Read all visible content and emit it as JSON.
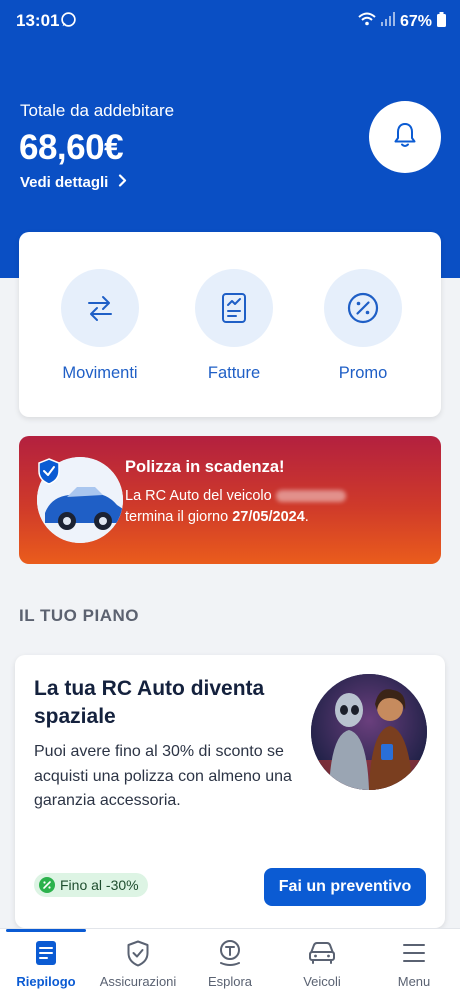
{
  "status_bar": {
    "time": "13:01",
    "battery": "67%"
  },
  "header": {
    "total_label": "Totale da addebitare",
    "total_amount": "68,60€",
    "details_link": "Vedi dettagli"
  },
  "quick_actions": [
    {
      "label": "Movimenti",
      "icon": "transfer-arrows-icon"
    },
    {
      "label": "Fatture",
      "icon": "invoice-icon"
    },
    {
      "label": "Promo",
      "icon": "percent-icon"
    }
  ],
  "alert": {
    "title": "Polizza in scadenza!",
    "text_prefix": "La RC Auto del veicolo",
    "text_middle": "termina il giorno",
    "date": "27/05/2024",
    "suffix": "."
  },
  "plan_section": {
    "title": "IL TUO PIANO",
    "card_title": "La tua RC Auto diventa spaziale",
    "card_body": "Puoi avere fino al 30% di sconto se acquisti una polizza con almeno una garanzia accessoria.",
    "badge": "Fino al -30%",
    "cta": "Fai un preventivo"
  },
  "bottom_nav": [
    {
      "label": "Riepilogo",
      "icon": "document-list-icon",
      "active": true
    },
    {
      "label": "Assicurazioni",
      "icon": "shield-check-icon",
      "active": false
    },
    {
      "label": "Esplora",
      "icon": "compass-pin-icon",
      "active": false
    },
    {
      "label": "Veicoli",
      "icon": "car-icon",
      "active": false
    },
    {
      "label": "Menu",
      "icon": "hamburger-icon",
      "active": false
    }
  ],
  "colors": {
    "brand_blue": "#0a4fc4",
    "action_blue": "#0b5bd3",
    "alert_gradient_top": "#b3203f",
    "alert_gradient_bottom": "#ea5c1c"
  }
}
